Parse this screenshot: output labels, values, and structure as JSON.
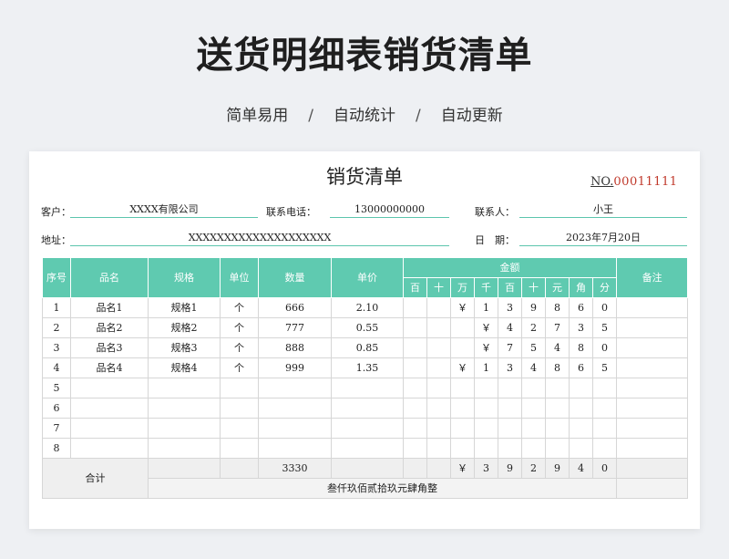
{
  "hero": {
    "title": "送货明细表销货清单",
    "features": [
      "简单易用",
      "自动统计",
      "自动更新"
    ],
    "separator": "/"
  },
  "document": {
    "title": "销货清单",
    "no_label": "NO.",
    "no_value": "00011111",
    "fields": {
      "customer_label": "客户：",
      "customer_value": "XXXX有限公司",
      "phone_label": "联系电话：",
      "phone_value": "13000000000",
      "contact_label": "联系人：",
      "contact_value": "小王",
      "address_label": "地址：",
      "address_value": "XXXXXXXXXXXXXXXXXXXX",
      "date_label": "日　期：",
      "date_value": "2023年7月20日"
    }
  },
  "table": {
    "headers": {
      "seq": "序号",
      "name": "品名",
      "spec": "规格",
      "unit": "单位",
      "qty": "数量",
      "price": "单价",
      "amount": "金额",
      "remark": "备注"
    },
    "digit_headers": [
      "百",
      "十",
      "万",
      "千",
      "百",
      "十",
      "元",
      "角",
      "分"
    ],
    "rows": [
      {
        "seq": "1",
        "name": "品名1",
        "spec": "规格1",
        "unit": "个",
        "qty": "666",
        "price": "2.10",
        "digits": [
          "",
          "",
          "￥",
          "1",
          "3",
          "9",
          "8",
          "6",
          "0"
        ],
        "remark": ""
      },
      {
        "seq": "2",
        "name": "品名2",
        "spec": "规格2",
        "unit": "个",
        "qty": "777",
        "price": "0.55",
        "digits": [
          "",
          "",
          "",
          "￥",
          "4",
          "2",
          "7",
          "3",
          "5"
        ],
        "remark": ""
      },
      {
        "seq": "3",
        "name": "品名3",
        "spec": "规格3",
        "unit": "个",
        "qty": "888",
        "price": "0.85",
        "digits": [
          "",
          "",
          "",
          "￥",
          "7",
          "5",
          "4",
          "8",
          "0"
        ],
        "remark": ""
      },
      {
        "seq": "4",
        "name": "品名4",
        "spec": "规格4",
        "unit": "个",
        "qty": "999",
        "price": "1.35",
        "digits": [
          "",
          "",
          "￥",
          "1",
          "3",
          "4",
          "8",
          "6",
          "5"
        ],
        "remark": ""
      },
      {
        "seq": "5",
        "name": "",
        "spec": "",
        "unit": "",
        "qty": "",
        "price": "",
        "digits": [
          "",
          "",
          "",
          "",
          "",
          "",
          "",
          "",
          ""
        ],
        "remark": ""
      },
      {
        "seq": "6",
        "name": "",
        "spec": "",
        "unit": "",
        "qty": "",
        "price": "",
        "digits": [
          "",
          "",
          "",
          "",
          "",
          "",
          "",
          "",
          ""
        ],
        "remark": ""
      },
      {
        "seq": "7",
        "name": "",
        "spec": "",
        "unit": "",
        "qty": "",
        "price": "",
        "digits": [
          "",
          "",
          "",
          "",
          "",
          "",
          "",
          "",
          ""
        ],
        "remark": ""
      },
      {
        "seq": "8",
        "name": "",
        "spec": "",
        "unit": "",
        "qty": "",
        "price": "",
        "digits": [
          "",
          "",
          "",
          "",
          "",
          "",
          "",
          "",
          ""
        ],
        "remark": ""
      }
    ],
    "total": {
      "label": "合计",
      "qty": "3330",
      "digits": [
        "",
        "",
        "￥",
        "3",
        "9",
        "2",
        "9",
        "4",
        "0"
      ],
      "words": "叁仟玖佰贰拾玖元肆角整"
    }
  }
}
